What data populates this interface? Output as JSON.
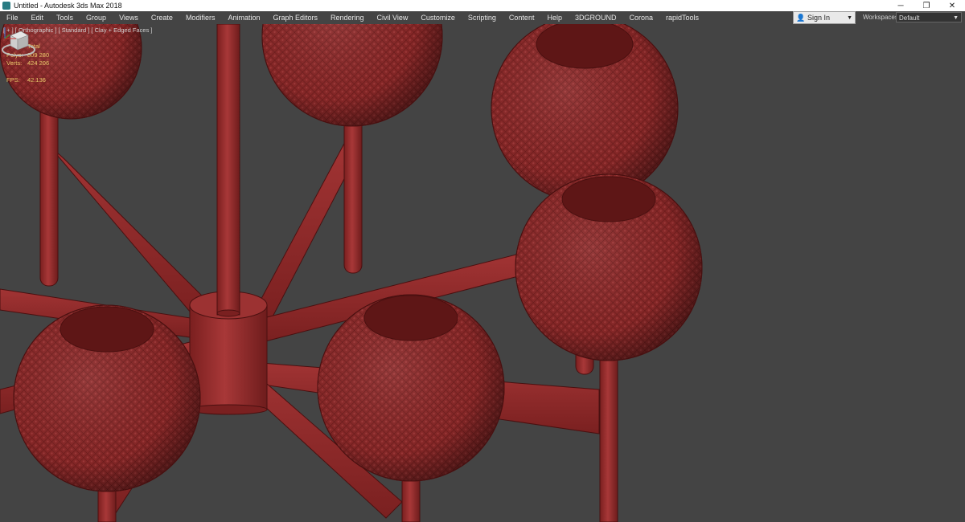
{
  "window": {
    "title": "Untitled - Autodesk 3ds Max 2018",
    "controls": {
      "minimize": "─",
      "restore": "❐",
      "close": "✕"
    }
  },
  "menu": {
    "items": [
      "File",
      "Edit",
      "Tools",
      "Group",
      "Views",
      "Create",
      "Modifiers",
      "Animation",
      "Graph Editors",
      "Rendering",
      "Civil View",
      "Customize",
      "Scripting",
      "Content",
      "Help",
      "3DGROUND",
      "Corona",
      "rapidTools"
    ]
  },
  "account": {
    "sign_in_label": "Sign In",
    "icon": "user-icon"
  },
  "workspaces": {
    "label": "Workspaces:",
    "value": "Default"
  },
  "viewport": {
    "label": "[ + ] [ Orthographic ] [ Standard ] [ Clay + Edged Faces ]",
    "stats": {
      "header": "Total",
      "polys_label": "Polys:",
      "polys_value": "809 280",
      "verts_label": "Verts:",
      "verts_value": "424 206",
      "fps_label": "FPS:",
      "fps_value": "42.136"
    },
    "object_color": "#8f2a2a",
    "background_color": "#444444"
  }
}
